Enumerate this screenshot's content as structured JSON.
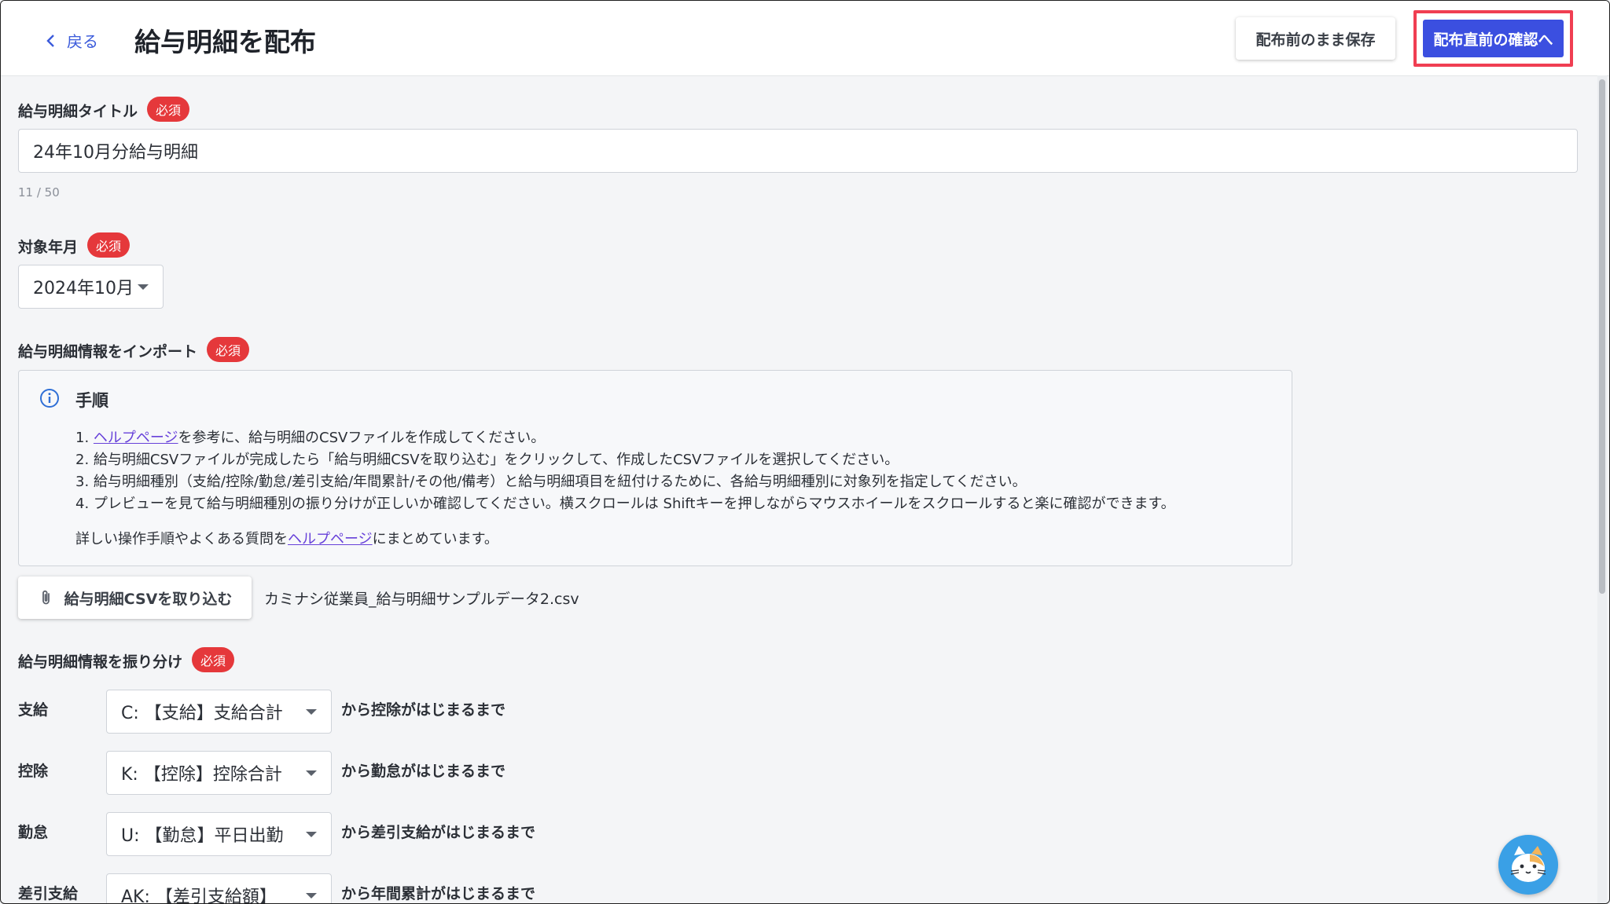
{
  "header": {
    "back_label": "戻る",
    "title": "給与明細を配布",
    "save_label": "配布前のまま保存",
    "confirm_label": "配布直前の確認へ"
  },
  "required_badge": "必須",
  "title_field": {
    "label": "給与明細タイトル",
    "value": "24年10月分給与明細",
    "counter": "11 / 50"
  },
  "target_month": {
    "label": "対象年月",
    "value": "2024年10月"
  },
  "import": {
    "label": "給与明細情報をインポート",
    "info_title": "手順",
    "step1_link": "ヘルプページ",
    "step1_text": "を参考に、給与明細のCSVファイルを作成してください。",
    "step2": "2. 給与明細CSVファイルが完成したら「給与明細CSVを取り込む」をクリックして、作成したCSVファイルを選択してください。",
    "step3": "3. 給与明細種別（支給/控除/勤怠/差引支給/年間累計/その他/備考）と給与明細項目を紐付けるために、各給与明細種別に対象列を指定してください。",
    "step4": "4. プレビューを見て給与明細種別の振り分けが正しいか確認してください。横スクロールは Shiftキーを押しながらマウスホイールをスクロールすると楽に確認ができます。",
    "detail_prefix": "詳しい操作手順やよくある質問を",
    "detail_link": "ヘルプページ",
    "detail_suffix": "にまとめています。",
    "button_label": "給与明細CSVを取り込む",
    "filename": "カミナシ従業員_給与明細サンプルデータ2.csv"
  },
  "mapping": {
    "label": "給与明細情報を振り分け",
    "rows": [
      {
        "label": "支給",
        "value": "C: 【支給】支給合計",
        "suffix": "から控除がはじまるまで"
      },
      {
        "label": "控除",
        "value": "K: 【控除】控除合計",
        "suffix": "から勤怠がはじまるまで"
      },
      {
        "label": "勤怠",
        "value": "U: 【勤怠】平日出勤",
        "suffix": "から差引支給がはじまるまで"
      },
      {
        "label": "差引支給",
        "value": "AK: 【差引支給額】",
        "suffix": "から年間累計がはじまるまで"
      }
    ]
  },
  "colors": {
    "primary": "#3b4fe0",
    "required": "#e5383b",
    "highlight": "#f03e52",
    "link": "#6741d9"
  }
}
